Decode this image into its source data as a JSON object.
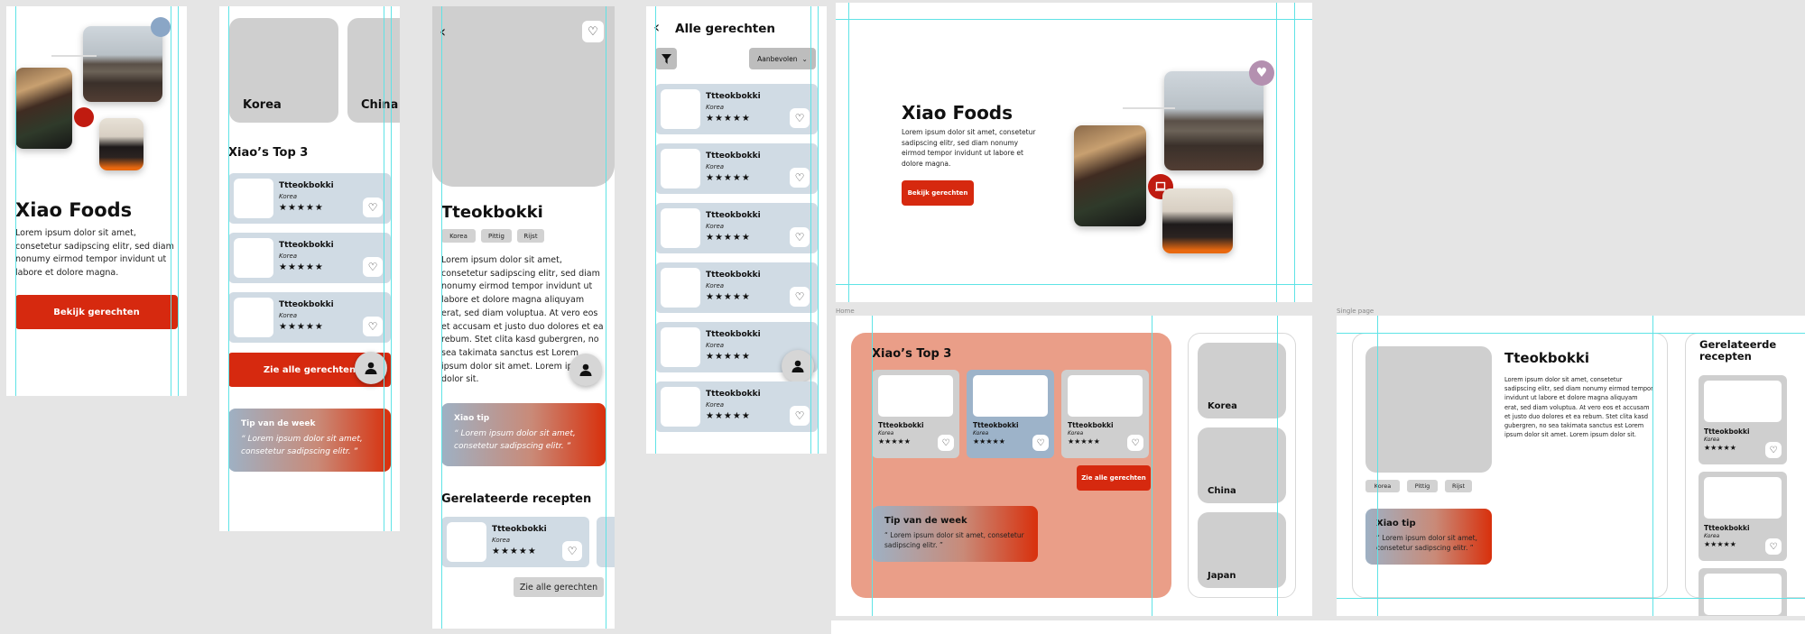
{
  "app": {
    "brand": "Xiao Foods",
    "accent": "#d6290f",
    "guide_color": "#5fe3e6",
    "bg": "#e5e5e5"
  },
  "home": {
    "title": "Xiao Foods",
    "body": "Lorem ipsum dolor sit amet, consetetur sadipscing elitr, sed diam nonumy eirmod tempor invidunt ut labore et dolore magna.",
    "cta": "Bekijk gerechten"
  },
  "categories": [
    "Korea",
    "China",
    "Japan"
  ],
  "top3": {
    "title": "Xiao’s Top 3",
    "see_all": "Zie alle gerechten",
    "items": [
      {
        "name": "Ttteokbokki",
        "country": "Korea",
        "stars": "★★★★★"
      },
      {
        "name": "Ttteokbokki",
        "country": "Korea",
        "stars": "★★★★★"
      },
      {
        "name": "Ttteokbokki",
        "country": "Korea",
        "stars": "★★★★★"
      }
    ]
  },
  "tip_week": {
    "title": "Tip van de week",
    "quote": "“ Lorem ipsum dolor sit amet, consetetur sadipscing elitr. ”"
  },
  "detail": {
    "title": "Tteokbokki",
    "tags": [
      "Korea",
      "Pittig",
      "Rijst"
    ],
    "body": "Lorem ipsum dolor sit amet, consetetur sadipscing elitr, sed diam nonumy eirmod tempor invidunt ut labore et dolore magna aliquyam erat, sed diam voluptua. At vero eos et accusam et justo duo dolores et ea rebum. Stet clita kasd gubergren, no sea takimata sanctus est Lorem ipsum dolor sit amet. Lorem ipsum dolor sit.",
    "tip_title": "Xiao tip",
    "tip_quote": "“ Lorem ipsum dolor sit amet, consetetur sadipscing elitr. ”",
    "related_title": "Gerelateerde recepten",
    "related_title_desktop": "Gerelateerde recepten",
    "related_item": {
      "name": "Ttteokbokki",
      "country": "Korea",
      "stars": "★★★★★"
    },
    "see_all": "Zie alle gerechten"
  },
  "list": {
    "title": "Alle gerechten",
    "sort": "Aanbevolen",
    "items": [
      {
        "name": "Ttteokbokki",
        "country": "Korea",
        "stars": "★★★★★"
      },
      {
        "name": "Ttteokbokki",
        "country": "Korea",
        "stars": "★★★★★"
      },
      {
        "name": "Ttteokbokki",
        "country": "Korea",
        "stars": "★★★★★"
      },
      {
        "name": "Ttteokbokki",
        "country": "Korea",
        "stars": "★★★★★"
      },
      {
        "name": "Ttteokbokki",
        "country": "Korea",
        "stars": "★★★★★"
      },
      {
        "name": "Ttteokbokki",
        "country": "Korea",
        "stars": "★★★★★"
      }
    ]
  },
  "frame_labels": {
    "home": "Home",
    "single": "Single page"
  },
  "icons": {
    "back": "chevron-left-icon",
    "heart": "heart-icon",
    "filter": "filter-icon",
    "user": "user-icon",
    "laptop": "laptop-icon"
  }
}
